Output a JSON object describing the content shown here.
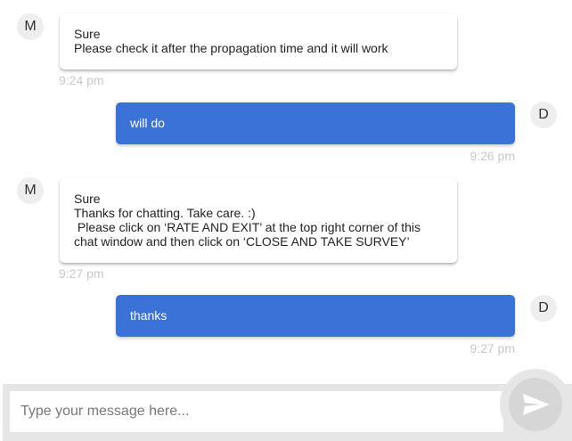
{
  "messages": [
    {
      "sender": "agent",
      "avatar": "M",
      "lines": [
        "Sure",
        "Please check it after the propagation time and it will work"
      ],
      "time": "9:24 pm"
    },
    {
      "sender": "user",
      "avatar": "D",
      "lines": [
        "will do"
      ],
      "time": "9:26 pm"
    },
    {
      "sender": "agent",
      "avatar": "M",
      "lines": [
        "Sure",
        "Thanks for chatting. Take care. :)",
        " Please click on ‘RATE AND EXIT’ at the top right corner of this",
        "chat window and then click on ‘CLOSE AND TAKE SURVEY’"
      ],
      "time": "9:27 pm"
    },
    {
      "sender": "user",
      "avatar": "D",
      "lines": [
        "thanks"
      ],
      "time": "9:27 pm"
    }
  ],
  "composer": {
    "placeholder": "Type your message here...",
    "send_icon": "send-icon"
  },
  "colors": {
    "user_bubble": "#3a72d8",
    "timestamp": "#c8c8c8",
    "composer_bg": "#e6e6e6"
  }
}
